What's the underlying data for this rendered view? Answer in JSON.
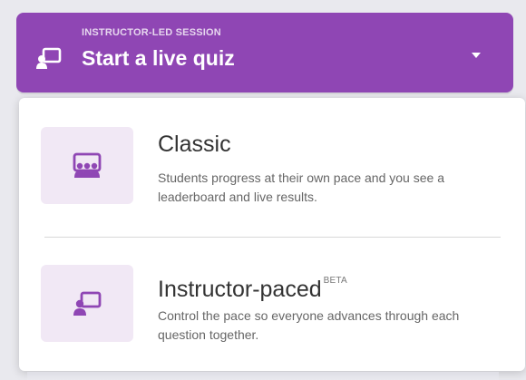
{
  "session_button": {
    "kicker": "INSTRUCTOR-LED SESSION",
    "title": "Start a live quiz",
    "icon": "presentation-icon",
    "chevron_icon": "caret-down-icon",
    "bg_color": "#8f46b4"
  },
  "menu": {
    "options": [
      {
        "title": "Classic",
        "badge": "",
        "description": "Students progress at their own pace and you see a leaderboard and live results.",
        "icon": "group-presentation-icon",
        "tile_color": "#f1e8f5"
      },
      {
        "title": "Instructor-paced",
        "badge": "BETA",
        "description": "Control the pace so everyone advances through each question together.",
        "icon": "instructor-board-icon",
        "tile_color": "#f1e8f5"
      }
    ]
  }
}
